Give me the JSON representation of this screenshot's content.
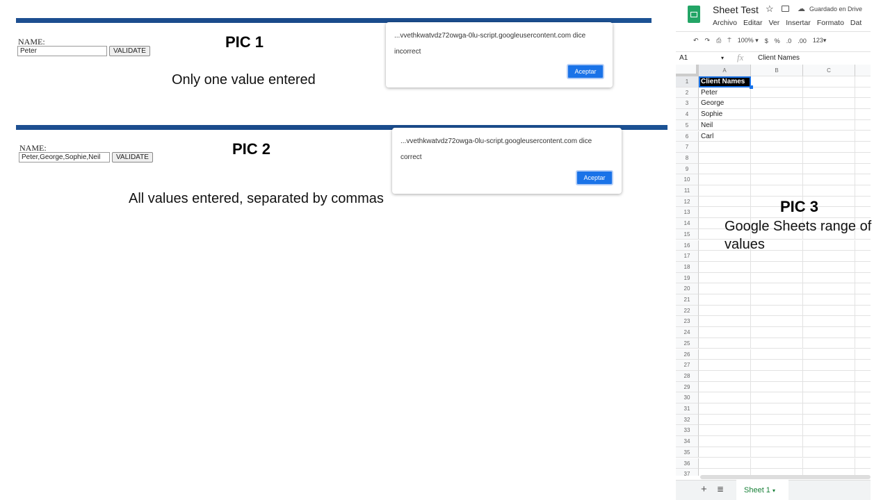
{
  "pic1": {
    "label": "NAME:",
    "input_value": "Peter",
    "button": "VALIDATE",
    "title": "PIC 1",
    "caption": "Only one value entered",
    "dialog": {
      "host": "...vvethkwatvdz72owga-0lu-script.googleusercontent.com dice",
      "message": "incorrect",
      "ok": "Aceptar"
    }
  },
  "pic2": {
    "label": "NAME:",
    "input_value": "Peter,George,Sophie,Neil",
    "button": "VALIDATE",
    "title": "PIC 2",
    "caption": "All values entered, separated by commas",
    "dialog": {
      "host": "...vvethkwatvdz72owga-0lu-script.googleusercontent.com dice",
      "message": "correct",
      "ok": "Aceptar"
    }
  },
  "pic3": {
    "title": "PIC 3",
    "caption": "Google Sheets range of values"
  },
  "sheets": {
    "doc_title": "Sheet Test",
    "saved_status": "Guardado en Drive",
    "menu": [
      "Archivo",
      "Editar",
      "Ver",
      "Insertar",
      "Formato",
      "Dat"
    ],
    "toolbar": {
      "zoom": "100%",
      "currency": "$",
      "percent": "%",
      "dec_less": ".0",
      "dec_more": ".00",
      "format": "123"
    },
    "name_box": "A1",
    "formula_value": "Client Names",
    "fx": "fx",
    "columns": [
      "A",
      "B",
      "C"
    ],
    "rows": [
      "Client Names",
      "Peter",
      "George",
      "Sophie",
      "Neil",
      "Carl"
    ],
    "row_count": 37,
    "sheet_tab": "Sheet 1",
    "brand_color": "#23a566"
  }
}
